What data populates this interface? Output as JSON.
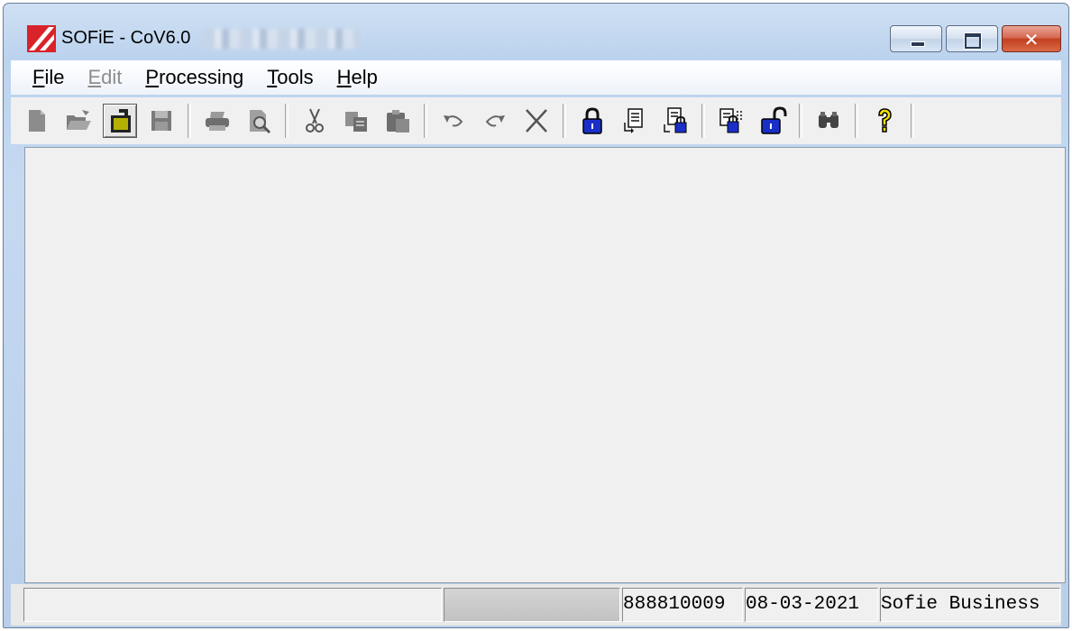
{
  "window": {
    "title": "SOFiE - CoV6.0",
    "app_icon": "sofie-logo-icon",
    "caption_buttons": [
      "minimize-icon",
      "maximize-icon",
      "close-icon"
    ]
  },
  "menubar": {
    "items": [
      {
        "mnemonic": "F",
        "rest": "ile",
        "enabled": true
      },
      {
        "mnemonic": "E",
        "rest": "dit",
        "enabled": false
      },
      {
        "mnemonic": "P",
        "rest": "rocessing",
        "enabled": true
      },
      {
        "mnemonic": "T",
        "rest": "ools",
        "enabled": true
      },
      {
        "mnemonic": "H",
        "rest": "elp",
        "enabled": true
      }
    ]
  },
  "toolbar": {
    "buttons": [
      "new-document-icon",
      "open-folder-icon",
      "open-company-icon",
      "save-icon",
      "print-icon",
      "print-preview-icon",
      "cut-icon",
      "copy-icon",
      "paste-icon",
      "undo-icon",
      "redo-icon",
      "delete-icon",
      "lock-icon",
      "document-list-icon",
      "document-lock-icon",
      "transfer-lock-icon",
      "unlock-icon",
      "find-icon",
      "help-icon"
    ]
  },
  "statusbar": {
    "panels": [
      "",
      "",
      "888810009",
      "08-03-2021",
      "Sofie Business"
    ]
  },
  "colors": {
    "title_gradient_top": "#cfe0f3",
    "close_button": "#c3401f",
    "lock_blue": "#1a2fc8",
    "help_yellow": "#f2e000"
  }
}
